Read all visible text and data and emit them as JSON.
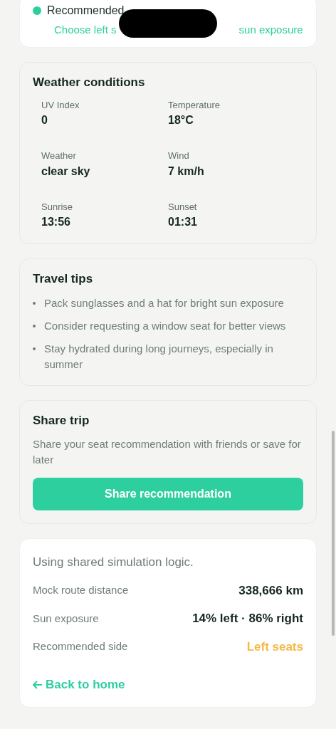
{
  "recommendation_card": {
    "status": "Recommended",
    "hint_start": "Choose left s",
    "hint_end": "sun exposure"
  },
  "weather": {
    "title": "Weather conditions",
    "items": [
      {
        "label": "UV Index",
        "value": "0"
      },
      {
        "label": "Temperature",
        "value": "18°C"
      },
      {
        "label": "Weather",
        "value": "clear sky"
      },
      {
        "label": "Wind",
        "value": "7 km/h"
      },
      {
        "label": "Sunrise",
        "value": "13:56"
      },
      {
        "label": "Sunset",
        "value": "01:31"
      }
    ]
  },
  "tips": {
    "title": "Travel tips",
    "items": [
      "Pack sunglasses and a hat for bright sun exposure",
      "Consider requesting a window seat for better views",
      "Stay hydrated during long journeys, especially in summer"
    ]
  },
  "share": {
    "title": "Share trip",
    "text": "Share your seat recommendation with friends or save for later",
    "button": "Share recommendation"
  },
  "summary": {
    "note": "Using shared simulation logic.",
    "rows": [
      {
        "label": "Mock route distance",
        "value": "338,666 km",
        "kind": "plain"
      },
      {
        "label": "Sun exposure",
        "value": "14% left · 86% right",
        "kind": "plain"
      },
      {
        "label": "Recommended side",
        "value": "Left seats",
        "kind": "highlight"
      }
    ],
    "back_link": "Back to home"
  }
}
